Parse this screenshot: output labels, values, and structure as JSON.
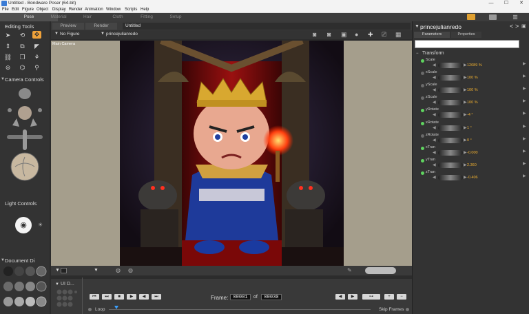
{
  "window": {
    "title": "Untitled - Bondware Poser (64-bit)",
    "controls": [
      "—",
      "☐",
      "✕"
    ]
  },
  "menu": [
    "File",
    "Edit",
    "Figure",
    "Object",
    "Display",
    "Render",
    "Animation",
    "Window",
    "Scripts",
    "Help"
  ],
  "rooms": [
    {
      "label": "Pose",
      "active": true
    },
    {
      "label": "Material",
      "active": false
    },
    {
      "label": "Hair",
      "active": false
    },
    {
      "label": "Cloth",
      "active": false
    },
    {
      "label": "Fitting",
      "active": false
    },
    {
      "label": "Setup",
      "active": false
    }
  ],
  "left": {
    "editing_tools": "Editing Tools",
    "camera_controls": "Camera Controls",
    "light_controls": "Light Controls",
    "document_display": "Document Di"
  },
  "view": {
    "tabs": [
      "Preview",
      "Render"
    ],
    "doc_tab": "Untitled",
    "figure_select": "No Figure",
    "actor_select": "princejulianredo",
    "camera_label": "Main Camera"
  },
  "bottom": {
    "ui_dots": "UI D...",
    "frame_label": "Frame:",
    "frame_current": "00001",
    "frame_of": "of",
    "frame_total": "00030",
    "loop_label": "Loop",
    "skip_frames_label": "Skip Frames"
  },
  "right": {
    "actor_title": "princejulianredo",
    "tabs": [
      "Parameters",
      "Properties"
    ],
    "search_placeholder": "",
    "group": "Transform",
    "params": [
      {
        "name": "Scale",
        "value": "12089 %",
        "active": true
      },
      {
        "name": "xScale",
        "value": "100 %",
        "active": false
      },
      {
        "name": "yScale",
        "value": "100 %",
        "active": false
      },
      {
        "name": "zScale",
        "value": "100 %",
        "active": false
      },
      {
        "name": "yRotate",
        "value": "-4 °",
        "active": true
      },
      {
        "name": "xRotate",
        "value": "1 °",
        "active": true
      },
      {
        "name": "zRotate",
        "value": "0 °",
        "active": false
      },
      {
        "name": "xTran",
        "value": "-0.000",
        "active": true
      },
      {
        "name": "yTran",
        "value": "2.360",
        "active": true
      },
      {
        "name": "zTran",
        "value": "-0.406",
        "active": true
      }
    ]
  },
  "colors": {
    "accent": "#f0a23a",
    "value": "#f0b030",
    "active_dot": "#5fd35f",
    "inactive_dot": "#6a6a6a"
  }
}
